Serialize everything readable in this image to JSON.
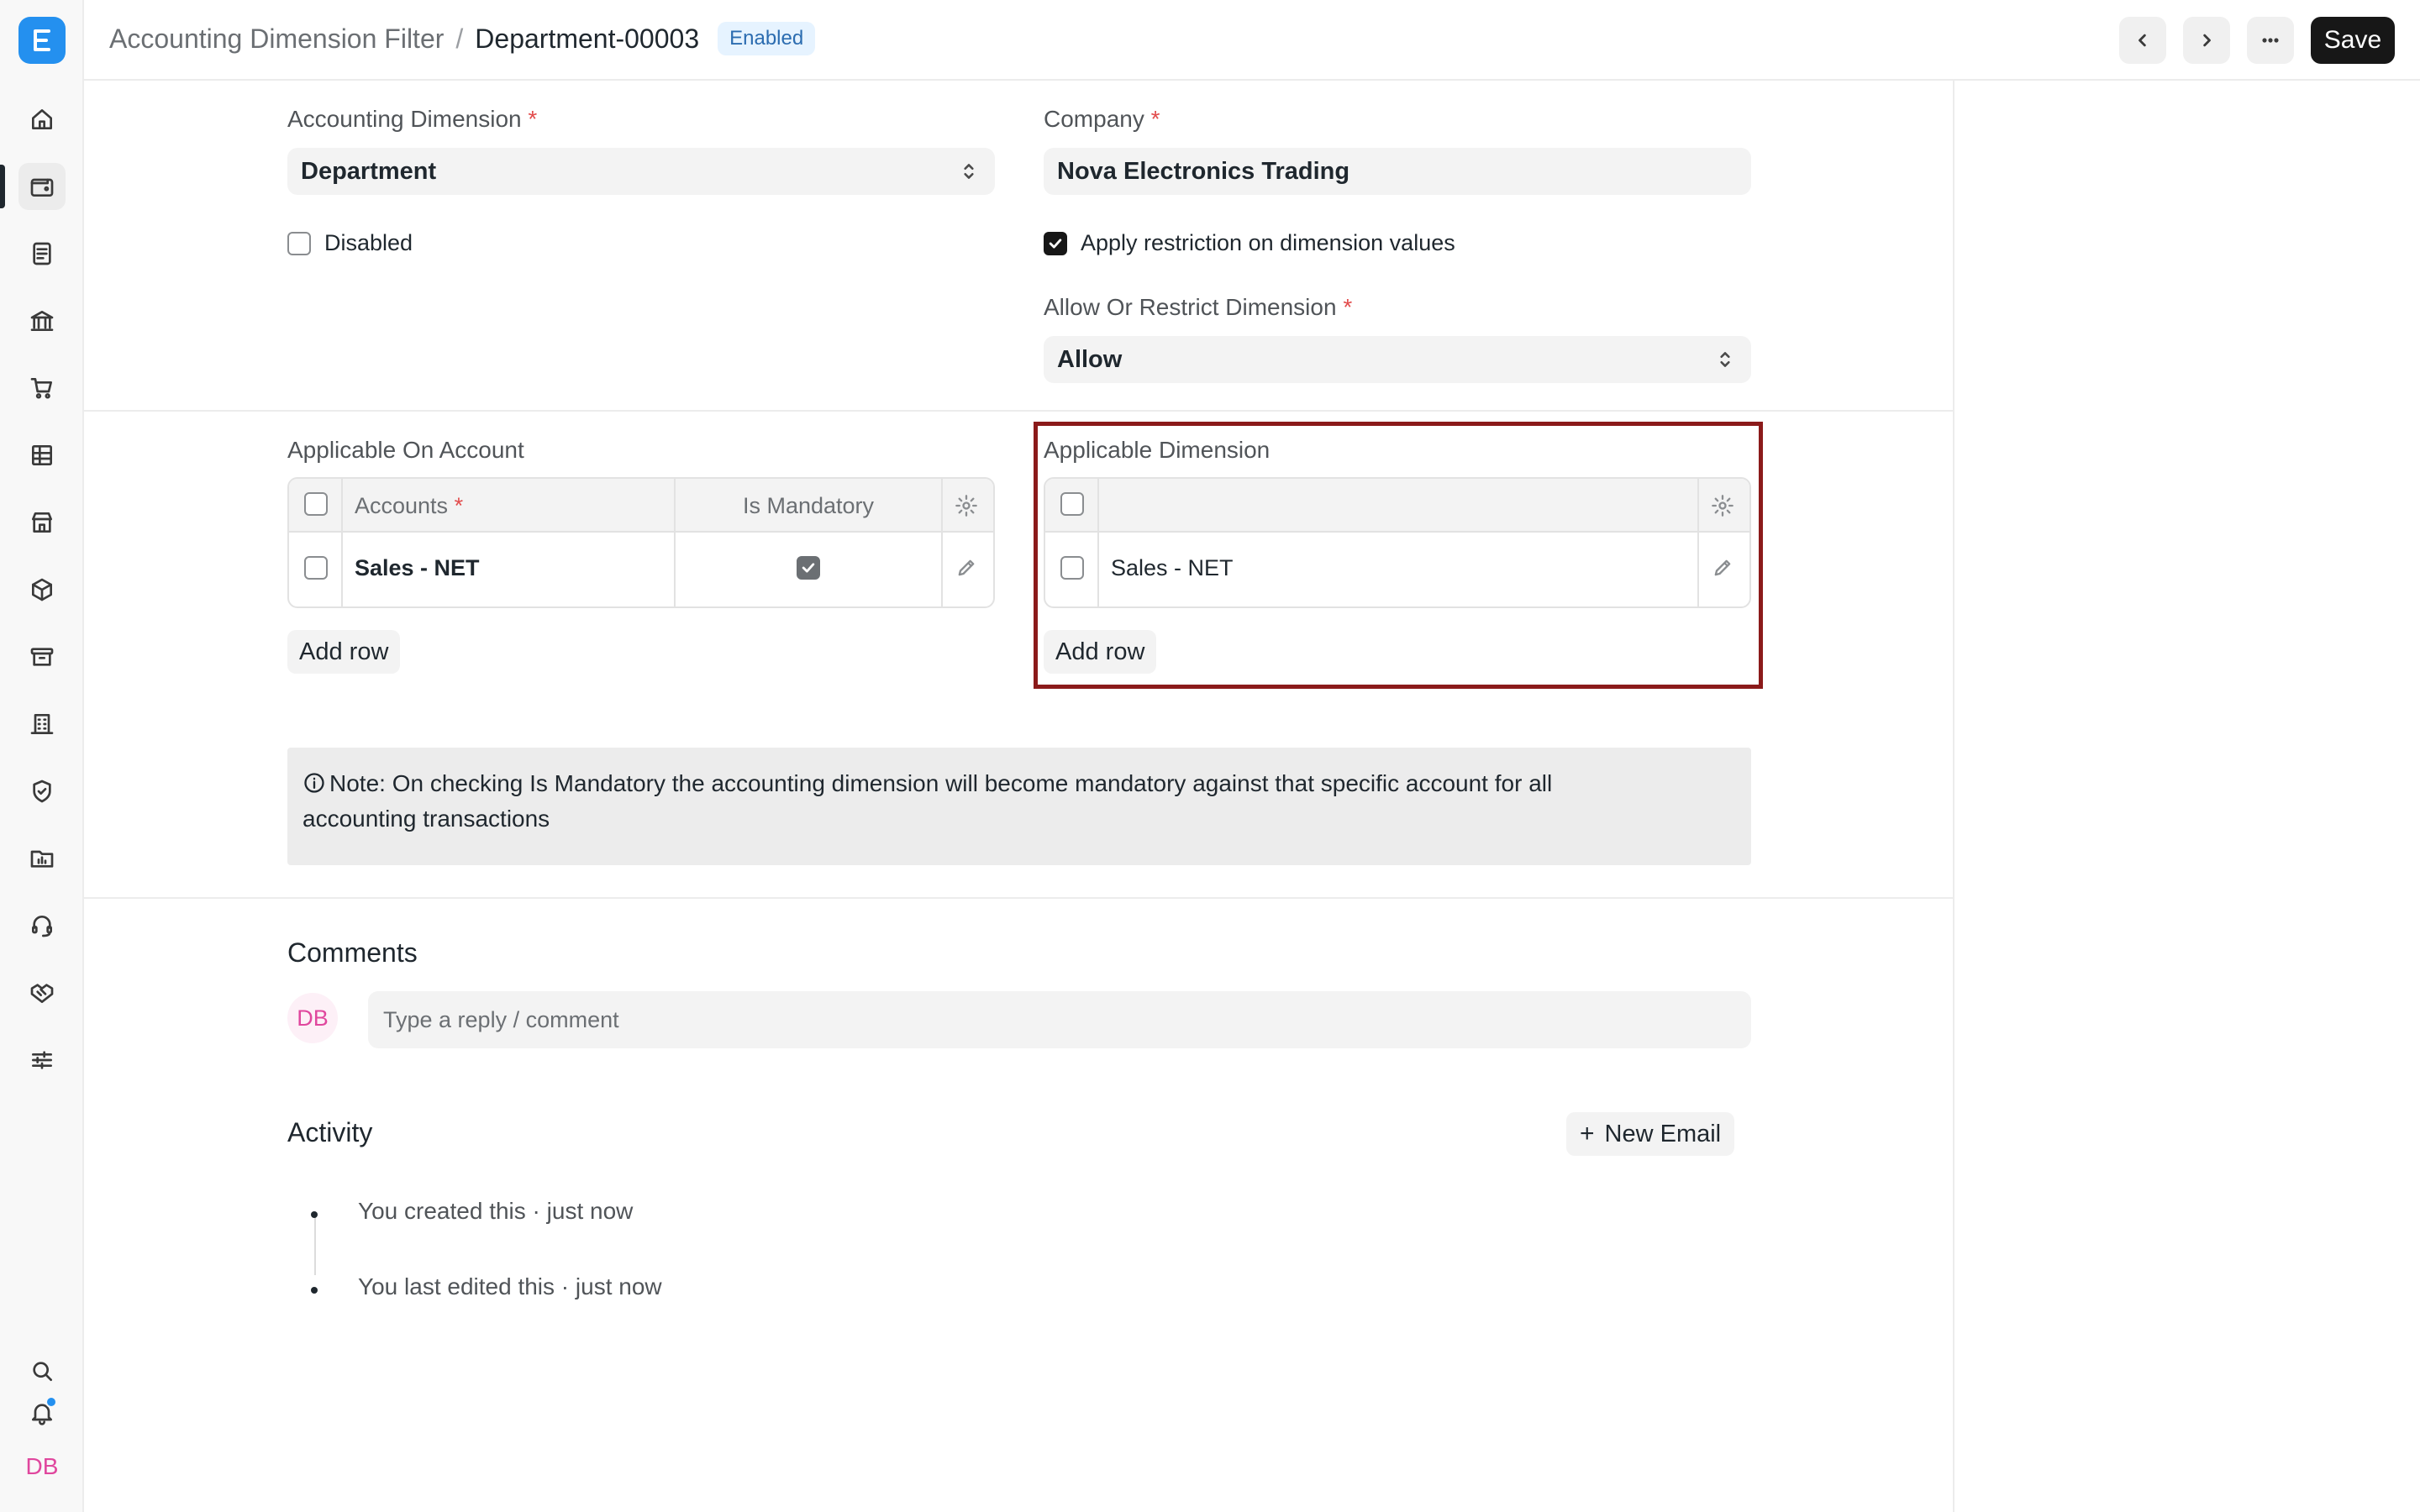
{
  "header": {
    "parent": "Accounting Dimension Filter",
    "separator": "/",
    "current": "Department-00003",
    "status_badge": "Enabled",
    "save_label": "Save"
  },
  "sidebar": {
    "logo": "E",
    "items": [
      "home-icon",
      "wallet-icon",
      "document-icon",
      "bank-icon",
      "cart-icon",
      "table-icon",
      "store-icon",
      "box-icon",
      "archive-icon",
      "building-icon",
      "shield-icon",
      "folder-icon",
      "headset-icon",
      "handshake-icon",
      "sliders-icon"
    ],
    "avatar_initials": "DB"
  },
  "form": {
    "accounting_dimension": {
      "label": "Accounting Dimension",
      "value": "Department"
    },
    "company": {
      "label": "Company",
      "value": "Nova Electronics Trading"
    },
    "disabled": {
      "label": "Disabled",
      "checked": false
    },
    "apply_restriction": {
      "label": "Apply restriction on dimension values",
      "checked": true
    },
    "allow_or_restrict": {
      "label": "Allow Or Restrict Dimension",
      "value": "Allow"
    },
    "required_marker": "*"
  },
  "applicable_on_account": {
    "label": "Applicable On Account",
    "columns": [
      "Accounts",
      "Is Mandatory"
    ],
    "rows": [
      {
        "account": "Sales - NET",
        "is_mandatory": true
      }
    ],
    "add_row_label": "Add row"
  },
  "applicable_dimension": {
    "label": "Applicable Dimension",
    "rows": [
      {
        "value": "Sales - NET"
      }
    ],
    "add_row_label": "Add row"
  },
  "note": {
    "line1": "Note: On checking Is Mandatory the accounting dimension will become mandatory against that specific account for all",
    "line2": "accounting transactions"
  },
  "comments": {
    "title": "Comments",
    "avatar": "DB",
    "placeholder": "Type a reply / comment"
  },
  "activity": {
    "title": "Activity",
    "new_email_label": "New Email",
    "items": [
      "You created this · just now",
      "You last edited this · just now"
    ]
  },
  "colors": {
    "accent": "#2490ef",
    "highlight_border": "#8b1a1a",
    "avatar_pink": "#e0479e"
  }
}
